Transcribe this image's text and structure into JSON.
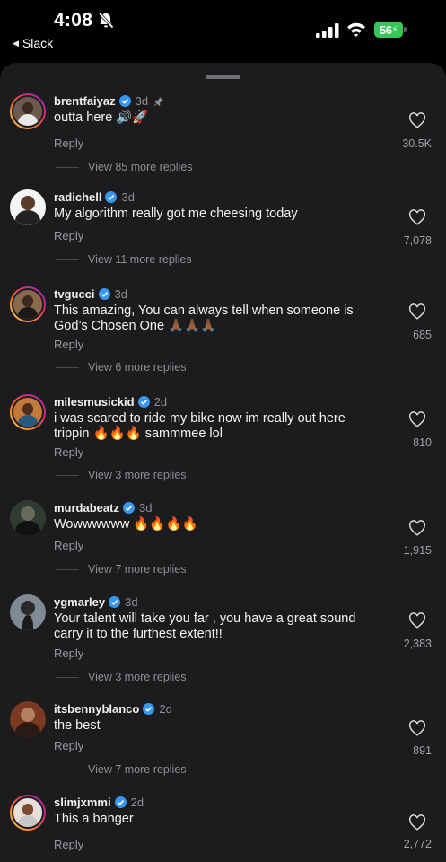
{
  "status_bar": {
    "time": "4:08",
    "back_label": "Slack",
    "battery": "56"
  },
  "colors": {
    "background": "#1c1c1e",
    "verified": "#3897f0",
    "battery": "#34c759"
  },
  "comments": [
    {
      "username": "brentfaiyaz",
      "ago": "3d",
      "pinned": true,
      "text": "outta here 🔊🚀",
      "reply_label": "Reply",
      "view_more": "View 85 more replies",
      "likes": "30.5K",
      "story_ring": true
    },
    {
      "username": "radichell",
      "ago": "3d",
      "pinned": false,
      "text": "My algorithm really got me cheesing today",
      "reply_label": "Reply",
      "view_more": "View 11 more replies",
      "likes": "7,078",
      "story_ring": false
    },
    {
      "username": "tvgucci",
      "ago": "3d",
      "pinned": false,
      "text": "This amazing, You can always tell when someone is God’s Chosen One 🙏🏾🙏🏾🙏🏾",
      "reply_label": "Reply",
      "view_more": "View 6 more replies",
      "likes": "685",
      "story_ring": true
    },
    {
      "username": "milesmusickid",
      "ago": "2d",
      "pinned": false,
      "text": "i was scared to ride my bike now im really out here trippin 🔥🔥🔥 sammmee lol",
      "reply_label": "Reply",
      "view_more": "View 3 more replies",
      "likes": "810",
      "story_ring": true
    },
    {
      "username": "murdabeatz",
      "ago": "3d",
      "pinned": false,
      "text": "Wowwwwww 🔥🔥🔥🔥",
      "reply_label": "Reply",
      "view_more": "View 7 more replies",
      "likes": "1,915",
      "story_ring": false
    },
    {
      "username": "ygmarley",
      "ago": "3d",
      "pinned": false,
      "text": "Your talent will take you far , you have a great sound carry it to the furthest extent!!",
      "reply_label": "Reply",
      "view_more": "View 3 more replies",
      "likes": "2,383",
      "story_ring": false
    },
    {
      "username": "itsbennyblanco",
      "ago": "2d",
      "pinned": false,
      "text": "the best",
      "reply_label": "Reply",
      "view_more": "View 7 more replies",
      "likes": "891",
      "story_ring": false
    },
    {
      "username": "slimjxmmi",
      "ago": "2d",
      "pinned": false,
      "text": "This a banger",
      "reply_label": "Reply",
      "view_more": "",
      "likes": "2,772",
      "story_ring": true
    }
  ]
}
